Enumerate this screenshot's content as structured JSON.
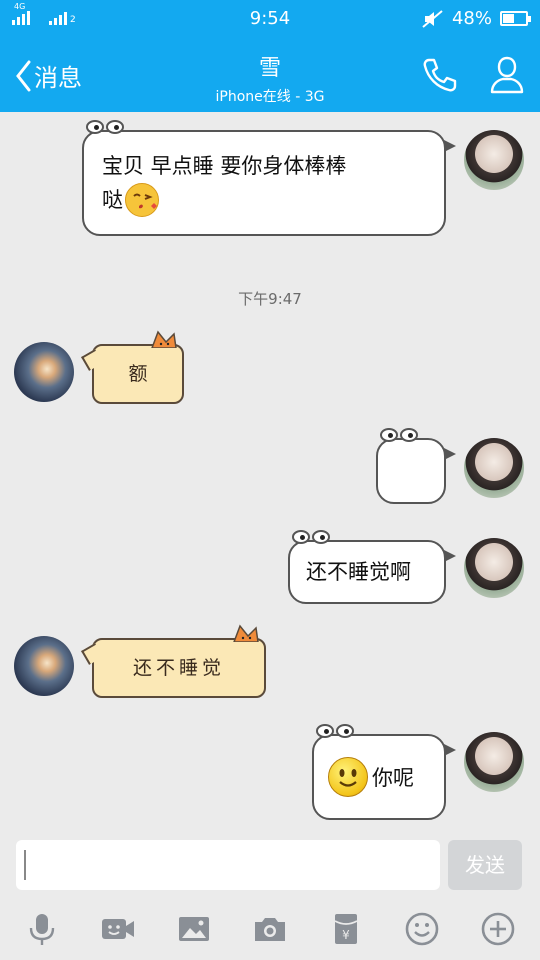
{
  "status": {
    "network": "4G",
    "sim2": "2",
    "time": "9:54",
    "battery": "48%",
    "battery_level": 0.48
  },
  "header": {
    "back_label": "消息",
    "title": "雪",
    "subtitle": "iPhone在线 - 3G"
  },
  "messages": [
    {
      "side": "sent",
      "line1": "宝贝 早点睡 要你身体棒棒",
      "line2": "哒",
      "emoji": "kiss-emoji"
    },
    {
      "side": "time",
      "text": "下午9:47"
    },
    {
      "side": "received",
      "text": "额"
    },
    {
      "side": "sent",
      "text": ""
    },
    {
      "side": "sent",
      "text": "还不睡觉啊"
    },
    {
      "side": "received",
      "text": "还不睡觉"
    },
    {
      "side": "sent",
      "text": "你呢",
      "emoji": "smile-emoji"
    }
  ],
  "composer": {
    "value": "",
    "send_label": "发送"
  },
  "toolbar": [
    "microphone-icon",
    "video-call-icon",
    "image-icon",
    "camera-icon",
    "red-packet-icon",
    "emoji-icon",
    "plus-icon"
  ],
  "colors": {
    "accent": "#13a9f0",
    "background": "#ebebeb",
    "cat_bubble": "#fbe8b6"
  }
}
